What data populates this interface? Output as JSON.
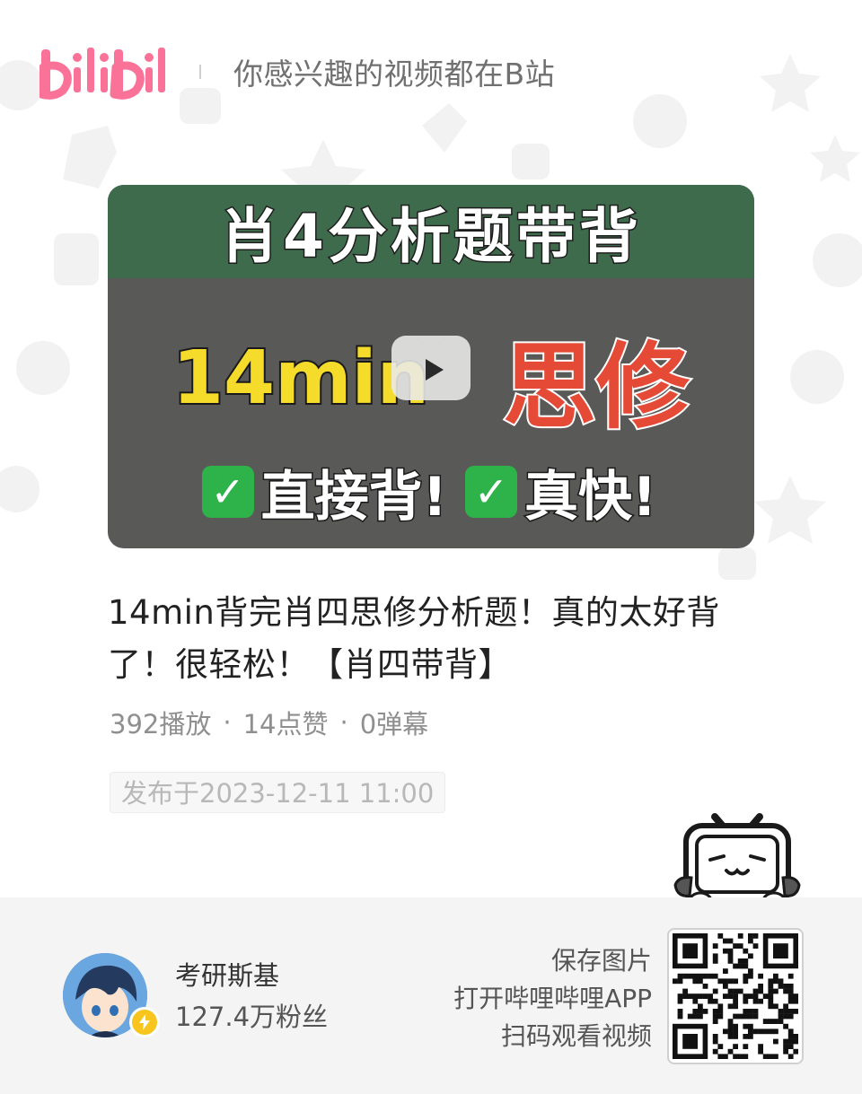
{
  "header": {
    "logo_text": "bilibili",
    "tagline": "你感兴趣的视频都在B站"
  },
  "thumbnail": {
    "title_line": "肖4分析题带背",
    "duration_text": "14min",
    "subject_text": "思修",
    "claim1": "直接背!",
    "claim2": "真快!",
    "check_glyph": "✓"
  },
  "video": {
    "title": "14min背完肖四思修分析题！真的太好背了！很轻松！【肖四带背】",
    "plays": "392播放",
    "likes": "14点赞",
    "danmaku": "0弹幕",
    "separator": "·",
    "published": "发布于2023-12-11 11:00"
  },
  "uploader": {
    "name": "考研斯基",
    "fans": "127.4万粉丝"
  },
  "qr": {
    "line1": "保存图片",
    "line2": "打开哔哩哔哩APP",
    "line3": "扫码观看视频"
  },
  "colors": {
    "brand_pink": "#fb7299",
    "thumb_green": "#3f6b4d",
    "thumb_gray": "#595a57",
    "accent_yellow": "#f5dc2a",
    "accent_red": "#e54a37",
    "check_green": "#2db34a",
    "footer_bg": "#f4f4f4"
  },
  "icons": {
    "play": "play-icon",
    "lightning": "lightning-badge-icon",
    "mascot": "tv-mascot-icon",
    "qr": "qr-code-icon"
  }
}
